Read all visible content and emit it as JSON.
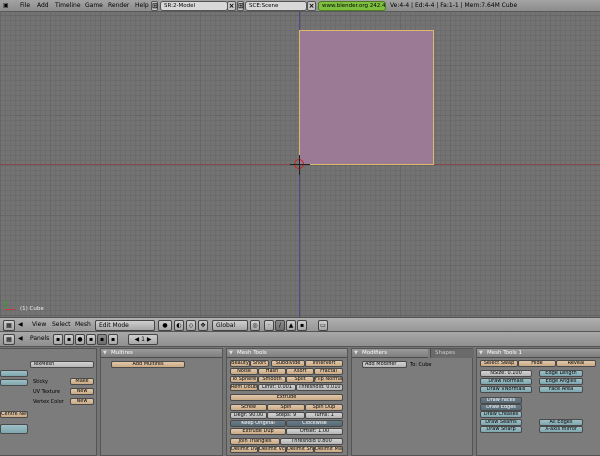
{
  "topbar": {
    "menus": [
      "File",
      "Add",
      "Timeline",
      "Game",
      "Render",
      "Help"
    ],
    "screen": "SR:2-Model",
    "scene": "SCE:Scene",
    "version": "www.blender.org 242.4",
    "stats": "Ve:4-4 | Ed:4-4 | Fa:1-1 | Mem:7.64M Cube"
  },
  "viewport": {
    "object_label": "(1) Cube"
  },
  "view_header": {
    "menus": [
      "View",
      "Select",
      "Mesh"
    ],
    "mode": "Edit Mode",
    "orientation": "Global"
  },
  "panels_header": {
    "label": "Panels",
    "page": "1"
  },
  "colors": {
    "mesh_face": "#9a7a94",
    "mesh_edge": "#ddb86a",
    "version_bg": "#7fbf3f"
  },
  "link_panel": {
    "texmesh": "TexMesh",
    "rows": [
      {
        "label": "Sticky",
        "button": "Make"
      },
      {
        "label": "UV Texture",
        "button": "New"
      },
      {
        "label": "Vertex Color",
        "button": "New"
      }
    ],
    "centre_new": "Centre New"
  },
  "multires": {
    "title": "Multires",
    "add": "Add Multires"
  },
  "mesh_tools": {
    "title": "Mesh Tools",
    "row1": [
      "Beauty",
      "Short",
      "Subdivide",
      "Innervert"
    ],
    "row2": [
      "Noise",
      "Hash",
      "Xsort",
      "Fractal"
    ],
    "row3": [
      "To Sphere",
      "Smooth",
      "Split",
      "Flip Normals"
    ],
    "row4": [
      "Rem Double",
      "Limit: 0.001",
      "Threshold: 0.010"
    ],
    "extrude": "Extrude",
    "row6": [
      "Screw",
      "Spin",
      "Spin Dup"
    ],
    "row7": [
      "Degr: 90.00",
      "Steps: 9",
      "Turns: 1"
    ],
    "row8": [
      "Keep Original",
      "Clockwise"
    ],
    "row9": [
      "Extrude Dup",
      "Offset: 1.00"
    ],
    "row10": [
      "Join Triangles",
      "Threshold 0.800"
    ],
    "row11": [
      "Delimit UVs",
      "Delimit Vcol",
      "Delimit Sharp",
      "Delimit Mat"
    ]
  },
  "modifiers": {
    "title": "Modifiers",
    "tab": "Shapes",
    "add": "Add Modifier",
    "target": "To: Cube"
  },
  "mesh_tools1": {
    "title": "Mesh Tools 1",
    "top": [
      "Select Swap",
      "Hide",
      "Reveal"
    ],
    "nsize": "NSize: 0.100",
    "draw_normals": "Draw Normals",
    "draw_vnormals": "Draw VNormals",
    "edge_length": "Edge Length",
    "edge_angles": "Edge Angles",
    "face_area": "Face Area",
    "draw_faces": "Draw Faces",
    "draw_edges": "Draw Edges",
    "draw_creases": "Draw Creases",
    "draw_seams": "Draw Seams",
    "draw_sharp": "Draw Sharp",
    "all_edges": "All Edges",
    "xaxis_mirror": "X-axis mirror"
  }
}
